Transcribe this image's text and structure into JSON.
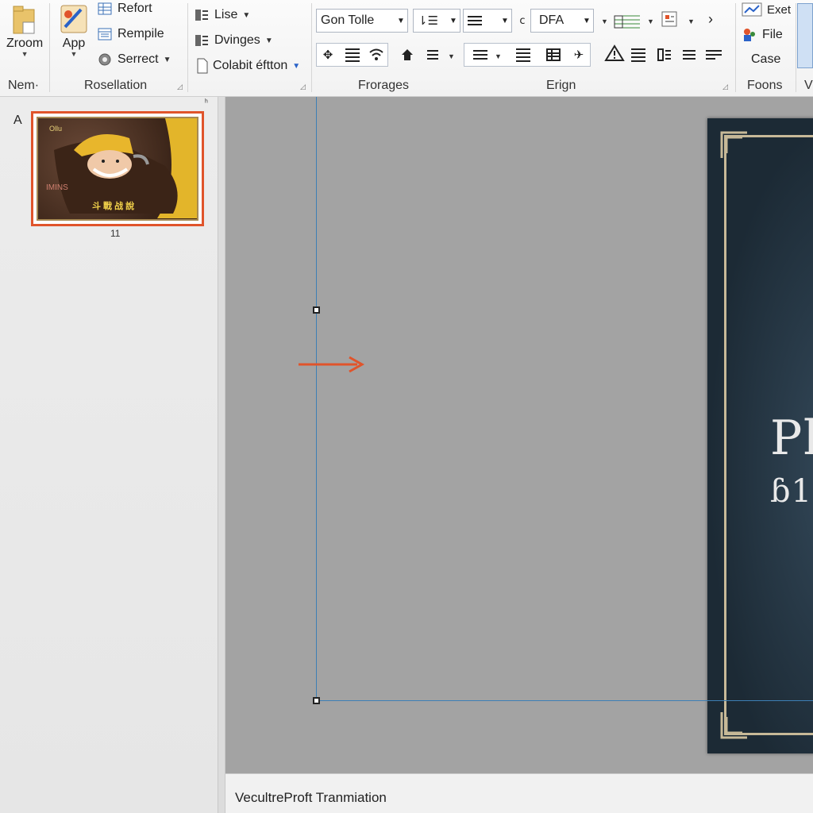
{
  "ribbon": {
    "groups": {
      "nem": {
        "label": "Nem·",
        "zoom_label": "Zroom"
      },
      "rosellation": {
        "label": "Rosellation",
        "app_label": "App",
        "refort": "Refort",
        "rempile": "Rempile",
        "serrect": "Serrect"
      },
      "lise": {
        "lise": "Lise",
        "dvinges": "Dvinges",
        "colabit": "Colabit éftton"
      },
      "frorages": {
        "label": "Frorages",
        "font_name": "Gon Tolle"
      },
      "erign": {
        "label": "Erign",
        "style_value": "DFA"
      },
      "foons": {
        "label": "Foons",
        "exet": "Exet",
        "file": "File",
        "case": "Case",
        "partial": "V"
      }
    }
  },
  "thumbnails": {
    "section_letter": "A",
    "slide_number": "11",
    "thumb_text_top": "Ollu",
    "thumb_text_mid": "IMINS",
    "thumb_text_bottom": "斗 戰 战 說"
  },
  "slide": {
    "title_partial": "Ph",
    "subtitle_partial": "ɓ1"
  },
  "status": {
    "text": "VecultreProft Tranmiation"
  },
  "colors": {
    "accent": "#e0542b",
    "guide": "#3d7fb5",
    "slide_bg": "#1c2a35",
    "frame": "#c7b998"
  }
}
